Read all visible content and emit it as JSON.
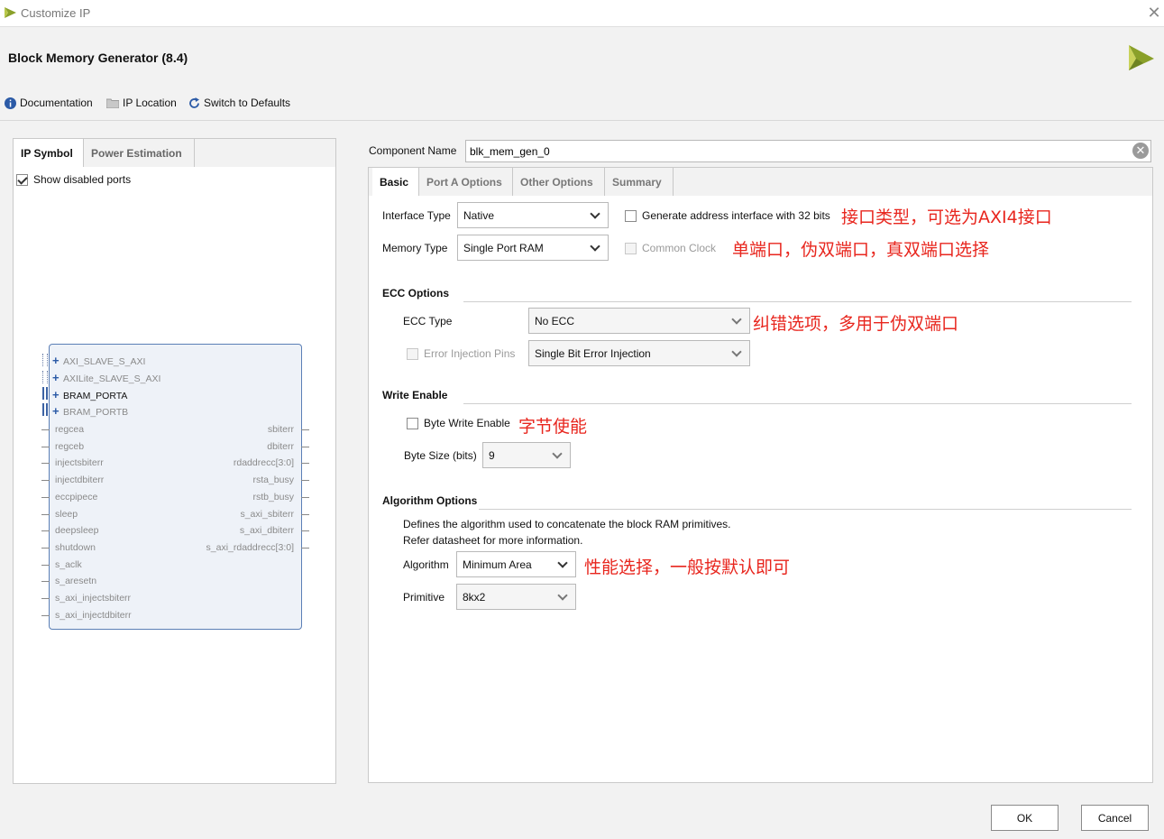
{
  "window": {
    "title": "Customize IP"
  },
  "header": {
    "title": "Block Memory Generator (8.4)"
  },
  "toolbar": {
    "documentation": "Documentation",
    "ip_location": "IP Location",
    "switch_defaults": "Switch to Defaults"
  },
  "left": {
    "tabs": [
      "IP Symbol",
      "Power Estimation"
    ],
    "show_disabled_ports": "Show disabled ports",
    "bus_ports": [
      "AXI_SLAVE_S_AXI",
      "AXILite_SLAVE_S_AXI",
      "BRAM_PORTA",
      "BRAM_PORTB"
    ],
    "left_ports": [
      "regcea",
      "regceb",
      "injectsbiterr",
      "injectdbiterr",
      "eccpipece",
      "sleep",
      "deepsleep",
      "shutdown",
      "s_aclk",
      "s_aresetn",
      "s_axi_injectsbiterr",
      "s_axi_injectdbiterr"
    ],
    "right_ports": [
      "sbiterr",
      "dbiterr",
      "rdaddrecc[3:0]",
      "rsta_busy",
      "rstb_busy",
      "s_axi_sbiterr",
      "s_axi_dbiterr",
      "s_axi_rdaddrecc[3:0]"
    ]
  },
  "component": {
    "label": "Component Name",
    "value": "blk_mem_gen_0"
  },
  "right": {
    "tabs": [
      "Basic",
      "Port A Options",
      "Other Options",
      "Summary"
    ],
    "interface_type": {
      "label": "Interface Type",
      "value": "Native"
    },
    "memory_type": {
      "label": "Memory Type",
      "value": "Single Port RAM"
    },
    "gen_address": "Generate address interface with 32 bits",
    "common_clock": "Common Clock",
    "ecc_section": "ECC Options",
    "ecc_type": {
      "label": "ECC Type",
      "value": "No ECC"
    },
    "error_injection": {
      "label": "Error Injection Pins",
      "value": "Single Bit Error Injection"
    },
    "write_enable_section": "Write Enable",
    "byte_write_enable": "Byte Write Enable",
    "byte_size": {
      "label": "Byte Size (bits)",
      "value": "9"
    },
    "algorithm_section": "Algorithm Options",
    "algo_desc_1": "Defines the algorithm used to concatenate the block RAM primitives.",
    "algo_desc_2": "Refer datasheet for more information.",
    "algorithm": {
      "label": "Algorithm",
      "value": "Minimum Area"
    },
    "primitive": {
      "label": "Primitive",
      "value": "8kx2"
    }
  },
  "annotations": {
    "interface": "接口类型，可选为AXI4接口",
    "memory": "单端口，伪双端口，真双端口选择",
    "ecc": "纠错选项，多用于伪双端口",
    "byte": "字节使能",
    "algorithm": "性能选择，一般按默认即可"
  },
  "buttons": {
    "ok": "OK",
    "cancel": "Cancel"
  },
  "colors": {
    "annotation": "#e8261e",
    "accent": "#2b5aa6",
    "logo": "#8aa02a"
  }
}
